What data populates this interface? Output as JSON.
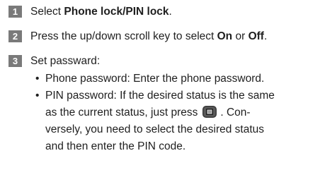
{
  "steps": [
    {
      "number": "1",
      "prefix": "Select ",
      "bold_text": "Phone lock/PIN lock",
      "suffix": "."
    },
    {
      "number": "2",
      "prefix": "Press the up/down scroll key to select ",
      "bold_on": "On",
      "middle": " or ",
      "bold_off": "Off",
      "suffix": "."
    },
    {
      "number": "3",
      "text": "Set passward:"
    }
  ],
  "bullets": {
    "symbol": "•",
    "phone": "Phone password: Enter the phone password.",
    "pin_line1": "PIN password: If the desired status is the same",
    "pin_line2a": "as the current status, just press",
    "pin_line2b": ". Con-",
    "pin_line3": "versely, you need to select the desired status",
    "pin_line4": "and then enter the PIN code."
  },
  "icons": {
    "ok_key": "ok-key-icon"
  },
  "colors": {
    "badge": "#7a7a7a",
    "text": "#1f1f1f"
  }
}
